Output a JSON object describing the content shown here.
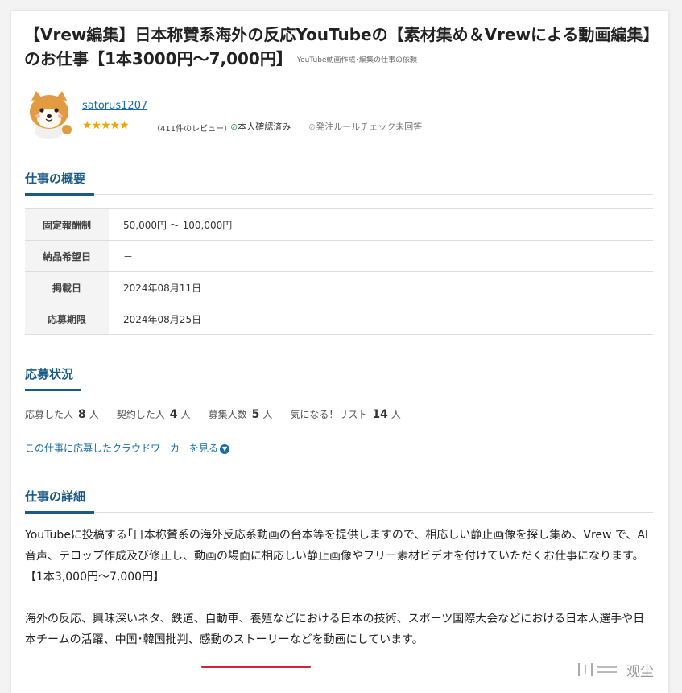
{
  "job": {
    "title": "【Vrew編集】日本称賛系海外の反応YouTubeの【素材集め＆Vrewによる動画編集】のお仕事【1本3000円～7,000円】",
    "category": "YouTube動画作成･編集の仕事の依頼"
  },
  "client": {
    "username": "satorus1207",
    "stars": "★★★★★",
    "review_count": "（411件のレビュー）",
    "verified": "本人確認済み",
    "rule_check": "発注ルールチェック未回答"
  },
  "overview": {
    "heading": "仕事の概要",
    "rows": [
      {
        "label": "固定報酬制",
        "value": "50,000円 ～ 100,000円"
      },
      {
        "label": "納品希望日",
        "value": "－"
      },
      {
        "label": "掲載日",
        "value": "2024年08月11日"
      },
      {
        "label": "応募期限",
        "value": "2024年08月25日"
      }
    ]
  },
  "status": {
    "heading": "応募状況",
    "applied_label": "応募した人",
    "applied_count": "8",
    "contracted_label": "契約した人",
    "contracted_count": "4",
    "recruit_label": "募集人数",
    "recruit_count": "5",
    "interested_label": "気になる！リスト",
    "interested_count": "14",
    "unit": "人",
    "applicants_link": "この仕事に応募したクラウドワーカーを見る"
  },
  "details": {
    "heading": "仕事の詳細",
    "para1": "YouTubeに投稿する｢日本称賛系の海外反応系動画の台本等を提供しますので、相応しい静止画像を探し集め、Vrew で、AI音声、テロップ作成及び修正し、動画の場面に相応しい静止画像やフリー素材ビデオを付けていただくお仕事になります。",
    "price_line": "【1本3,000円～7,000円】",
    "para2": "海外の反応、興味深いネタ、鉄道、自動車、養殖などにおける日本の技術、スポーツ国際大会などにおける日本人選手や日本チームの活躍、中国･韓国批判、感動のストーリーなどを動画にしています。"
  },
  "watermark": "观尘",
  "colors": {
    "accent": "#1a5a86",
    "link": "#1a6ea8",
    "star": "#f0a500",
    "highlight": "#d0263b"
  }
}
